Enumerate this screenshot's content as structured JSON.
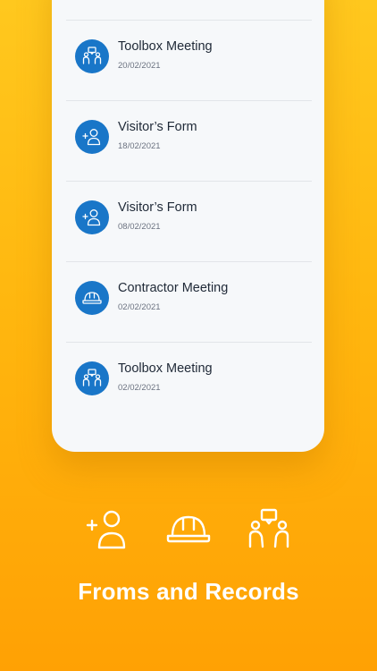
{
  "records": [
    {
      "title": "Toolbox Meeting",
      "date": "20/02/2021",
      "icon": "toolbox-meeting-icon"
    },
    {
      "title": "Visitor’s Form",
      "date": "18/02/2021",
      "icon": "visitor-add-icon"
    },
    {
      "title": "Visitor’s Form",
      "date": "08/02/2021",
      "icon": "visitor-add-icon"
    },
    {
      "title": "Contractor Meeting",
      "date": "02/02/2021",
      "icon": "hard-hat-icon"
    },
    {
      "title": "Toolbox Meeting",
      "date": "02/02/2021",
      "icon": "toolbox-meeting-icon"
    }
  ],
  "footer_icons": [
    "visitor-add-icon",
    "hard-hat-icon",
    "toolbox-meeting-icon"
  ],
  "caption": "Froms and Records",
  "colors": {
    "accent_blue": "#1976C8",
    "background_top": "#FFC81E",
    "background_bottom": "#FFA104",
    "card": "#F6F8FA"
  }
}
